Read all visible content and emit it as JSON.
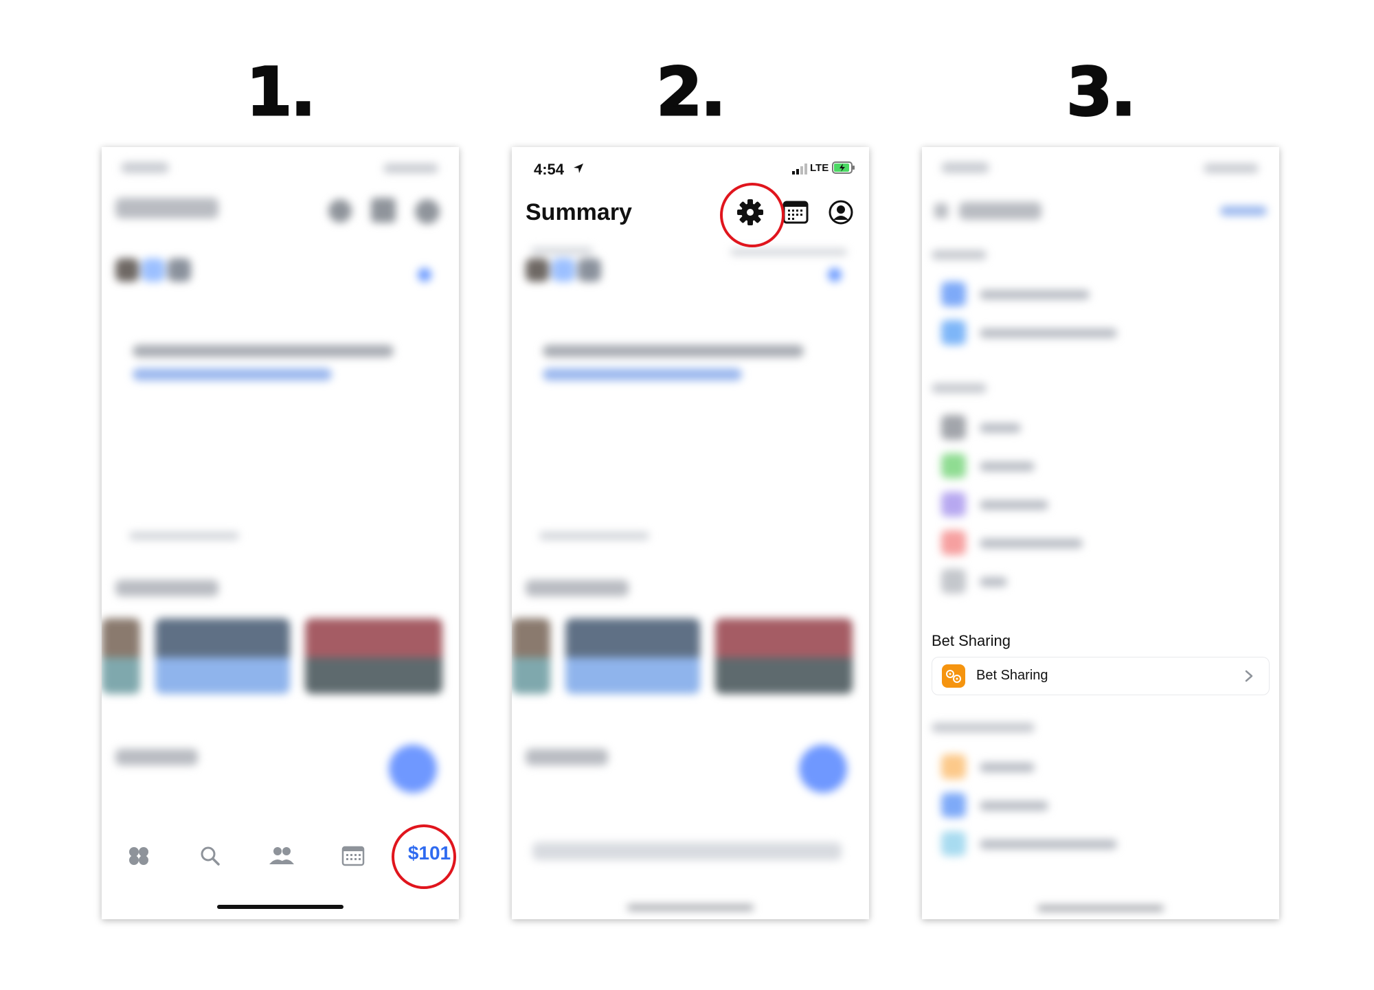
{
  "steps": [
    {
      "number": "1."
    },
    {
      "number": "2."
    },
    {
      "number": "3."
    }
  ],
  "phone2": {
    "status": {
      "time": "4:54",
      "network": "LTE"
    },
    "header": {
      "title": "Summary"
    },
    "icons": [
      "gear-icon",
      "calendar-icon",
      "profile-icon"
    ]
  },
  "phone1": {
    "tabbar": {
      "balance_label": "$101"
    }
  },
  "phone3": {
    "bet_sharing": {
      "section_title": "Bet Sharing",
      "row_label": "Bet Sharing",
      "icon": "bet-sharing-icon",
      "icon_color": "#f5940f"
    }
  },
  "colors": {
    "highlight": "#e0151d",
    "accent": "#2f6bf0"
  }
}
